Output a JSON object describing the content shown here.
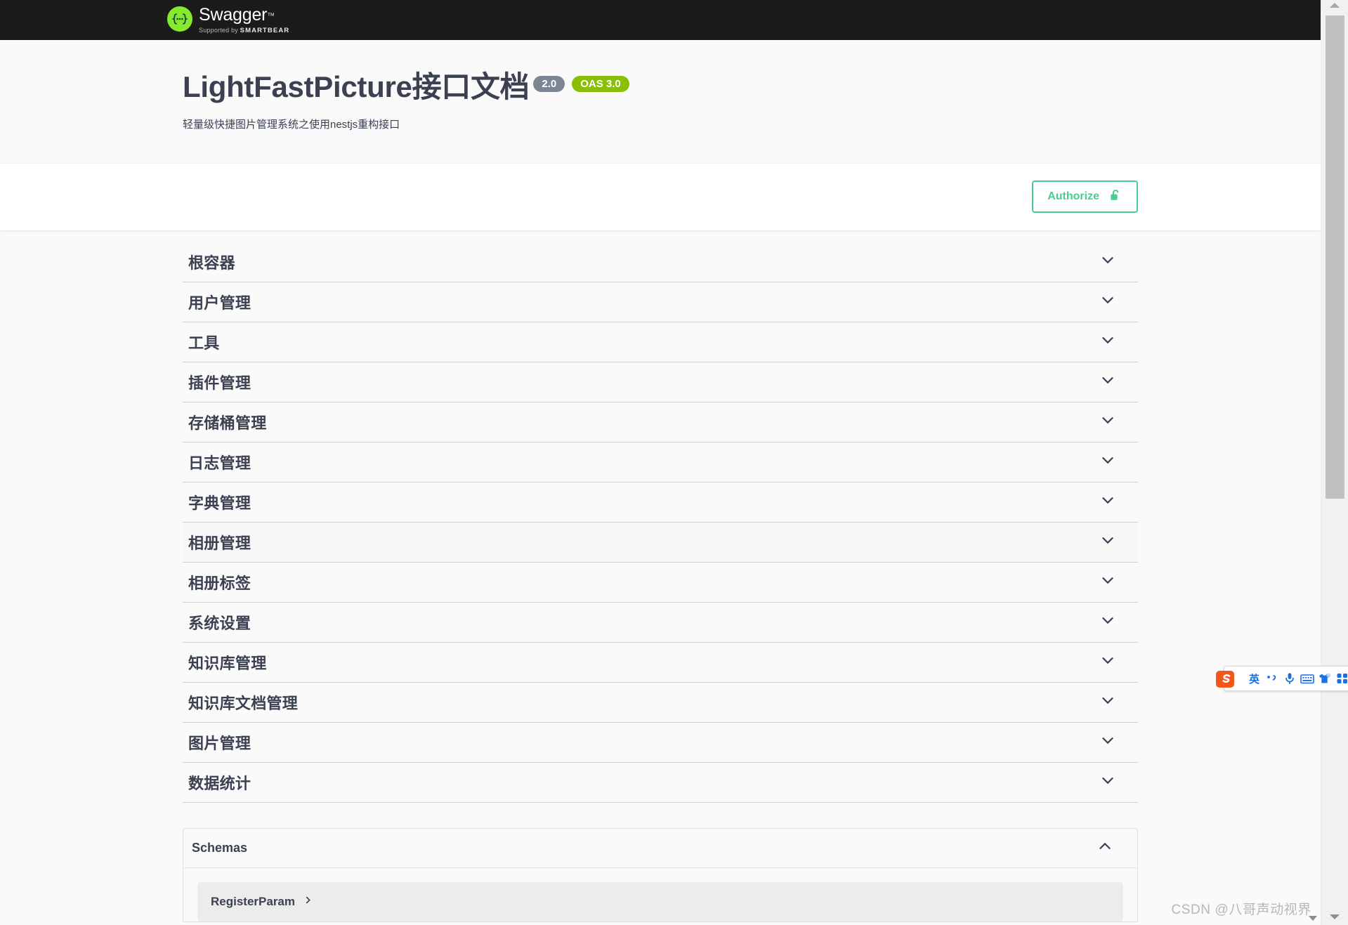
{
  "topbar": {
    "logo_icon": "swagger-braces-logo",
    "brand": "Swagger",
    "brand_tm": "™",
    "supported_by_prefix": "Supported by",
    "supported_by_brand": "SMARTBEAR"
  },
  "info": {
    "title": "LightFastPicture接口文档",
    "version_badge": "2.0",
    "oas_badge": "OAS 3.0",
    "description": "轻量级快捷图片管理系统之使用nestjs重构接口"
  },
  "auth": {
    "authorize_label": "Authorize",
    "lock_icon": "unlocked-padlock-icon"
  },
  "tags": [
    {
      "label": "根容器",
      "expanded": false,
      "hovered": false
    },
    {
      "label": "用户管理",
      "expanded": false,
      "hovered": false
    },
    {
      "label": "工具",
      "expanded": false,
      "hovered": false
    },
    {
      "label": "插件管理",
      "expanded": false,
      "hovered": false
    },
    {
      "label": "存储桶管理",
      "expanded": false,
      "hovered": false
    },
    {
      "label": "日志管理",
      "expanded": false,
      "hovered": false
    },
    {
      "label": "字典管理",
      "expanded": false,
      "hovered": false
    },
    {
      "label": "相册管理",
      "expanded": false,
      "hovered": true
    },
    {
      "label": "相册标签",
      "expanded": false,
      "hovered": false
    },
    {
      "label": "系统设置",
      "expanded": false,
      "hovered": false
    },
    {
      "label": "知识库管理",
      "expanded": false,
      "hovered": false
    },
    {
      "label": "知识库文档管理",
      "expanded": false,
      "hovered": false
    },
    {
      "label": "图片管理",
      "expanded": false,
      "hovered": false
    },
    {
      "label": "数据统计",
      "expanded": false,
      "hovered": false
    }
  ],
  "schemas": {
    "title": "Schemas",
    "collapse_icon": "chevron-up-icon",
    "models": [
      {
        "name": "RegisterParam",
        "expand_icon": "chevron-right-icon"
      }
    ]
  },
  "ime_toolbar": {
    "logo_icon": "sogou-s-logo-icon",
    "items": [
      {
        "icon": "language-mode-icon",
        "label": "英"
      },
      {
        "icon": "punctuation-toggle-icon",
        "label": "，"
      },
      {
        "icon": "microphone-icon",
        "label": ""
      },
      {
        "icon": "soft-keyboard-icon",
        "label": ""
      },
      {
        "icon": "skin-tshirt-icon",
        "label": ""
      },
      {
        "icon": "app-grid-icon",
        "label": ""
      }
    ]
  },
  "watermark": {
    "text": "CSDN @八哥声动视界"
  },
  "colors": {
    "topbar_bg": "#1b1b1b",
    "swagger_green": "#85ea2d",
    "authorize_green": "#49cc90",
    "oas_green": "#89bf04",
    "version_grey": "#7d8492",
    "text_dark": "#3b4151",
    "page_bg": "#fafafa"
  }
}
